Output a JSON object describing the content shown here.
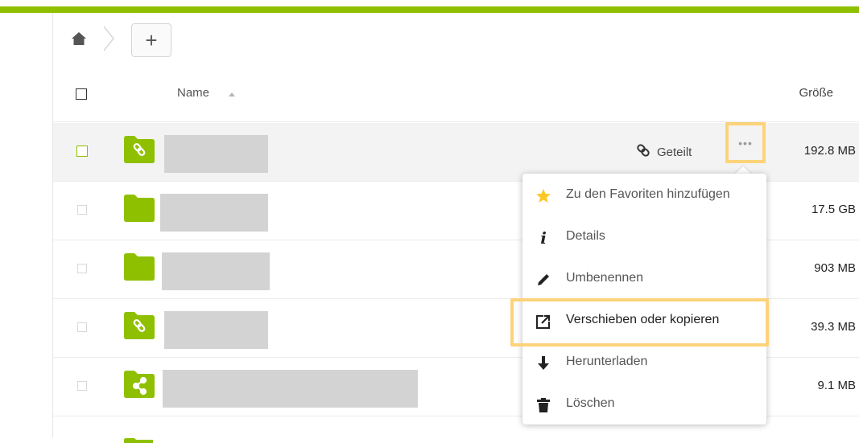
{
  "breadcrumb": {
    "home_icon": "home-icon",
    "add_label": "+"
  },
  "table": {
    "columns": {
      "name": "Name",
      "size": "Größe"
    },
    "rows": [
      {
        "icon": "folder-link-icon",
        "size": "192.8 MB",
        "shared_label": "Geteilt",
        "highlighted": true
      },
      {
        "icon": "folder-icon",
        "size": "17.5 GB"
      },
      {
        "icon": "folder-icon",
        "size": "903 MB"
      },
      {
        "icon": "folder-link-icon",
        "size": "39.3 MB"
      },
      {
        "icon": "folder-share-icon",
        "size": "9.1 MB"
      }
    ]
  },
  "more_button": {
    "label": "•••"
  },
  "context_menu": {
    "items": [
      {
        "label": "Zu den Favoriten hinzufügen",
        "icon": "star-icon"
      },
      {
        "label": "Details",
        "icon": "info-icon"
      },
      {
        "label": "Umbenennen",
        "icon": "pencil-icon"
      },
      {
        "label": "Verschieben oder kopieren",
        "icon": "move-icon",
        "highlighted": true
      },
      {
        "label": "Herunterladen",
        "icon": "download-icon"
      },
      {
        "label": "Löschen",
        "icon": "trash-icon"
      }
    ]
  },
  "colors": {
    "accent": "#8fc000",
    "highlight": "#fdd37a",
    "star": "#fcc728"
  }
}
